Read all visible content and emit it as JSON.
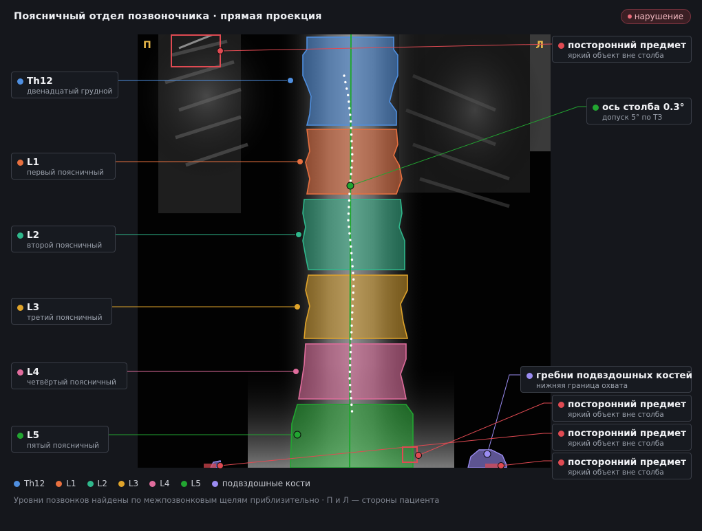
{
  "header": {
    "title": "Поясничный отдел позвоночника · прямая проекция",
    "badge": "нарушение"
  },
  "sides": {
    "right_patient": "П",
    "left_patient": "Л"
  },
  "colors": {
    "Th12": "#4f8fe0",
    "L1": "#e8703f",
    "L2": "#2fb88c",
    "L3": "#e0a42a",
    "L4": "#e06c9c",
    "L5": "#22a531",
    "ilium": "#9b8cf2",
    "foreign": "#e04a52",
    "badge": "#e76a78",
    "marker_side": "#e8b84a"
  },
  "vertebrae": [
    {
      "id": "Th12",
      "name": "Th12",
      "description": "двенадцатый грудной"
    },
    {
      "id": "L1",
      "name": "L1",
      "description": "первый поясничный"
    },
    {
      "id": "L2",
      "name": "L2",
      "description": "второй поясничный"
    },
    {
      "id": "L3",
      "name": "L3",
      "description": "третий поясничный"
    },
    {
      "id": "L4",
      "name": "L4",
      "description": "четвёртый поясничный"
    },
    {
      "id": "L5",
      "name": "L5",
      "description": "пятый поясничный"
    }
  ],
  "axis": {
    "title": "ось столба 0.3°",
    "note": "допуск 5° по ТЗ",
    "angle_deg": 0.3,
    "tolerance_deg": 5
  },
  "iliac": {
    "title": "гребни подвздошных костей",
    "note": "нижняя граница охвата"
  },
  "foreign_objects": [
    {
      "title": "посторонний предмет",
      "note": "яркий объект вне столба"
    },
    {
      "title": "посторонний предмет",
      "note": "яркий объект вне столба"
    },
    {
      "title": "посторонний предмет",
      "note": "яркий объект вне столба"
    },
    {
      "title": "посторонний предмет",
      "note": "яркий объект вне столба"
    }
  ],
  "legend": [
    {
      "label": "Th12",
      "color": "#4f8fe0"
    },
    {
      "label": "L1",
      "color": "#e8703f"
    },
    {
      "label": "L2",
      "color": "#2fb88c"
    },
    {
      "label": "L3",
      "color": "#e0a42a"
    },
    {
      "label": "L4",
      "color": "#e06c9c"
    },
    {
      "label": "L5",
      "color": "#22a531"
    },
    {
      "label": "подвздошные кости",
      "color": "#9b8cf2"
    }
  ],
  "footnote": "Уровни позвонков найдены по межпозвонковым щелям приблизительно · П и Л — стороны пациента"
}
